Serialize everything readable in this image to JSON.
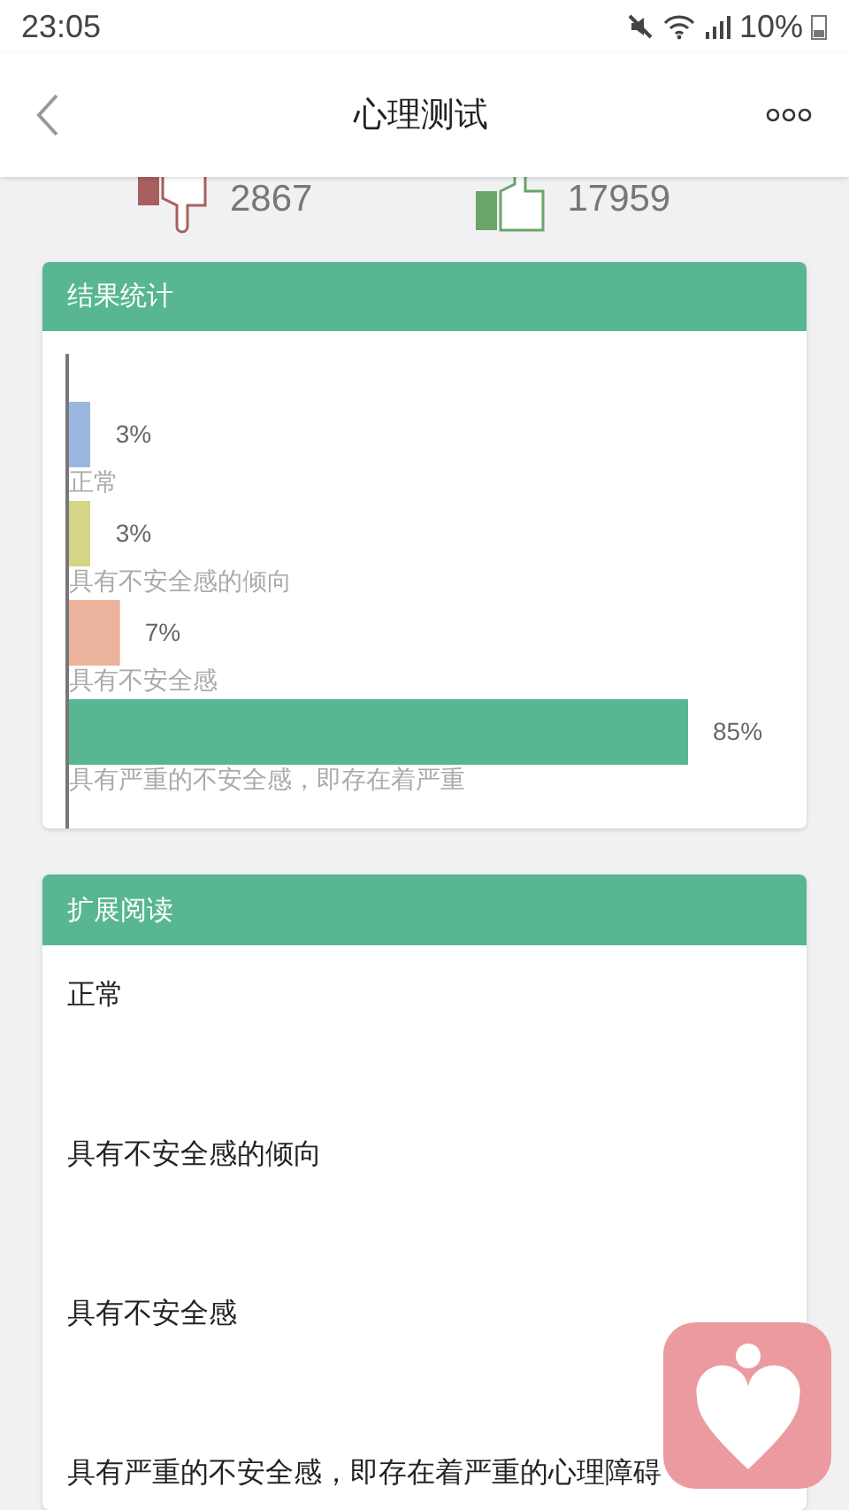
{
  "status_bar": {
    "time": "23:05",
    "battery": "10%"
  },
  "header": {
    "title": "心理测试"
  },
  "votes": {
    "dislikes": "2867",
    "likes": "17959"
  },
  "result_card": {
    "title": "结果统计",
    "chart_data": {
      "type": "bar",
      "orientation": "horizontal",
      "categories": [
        "正常",
        "具有不安全感的倾向",
        "具有不安全感",
        "具有严重的不安全感，即存在着严重"
      ],
      "values": [
        3,
        3,
        7,
        85
      ],
      "value_labels": [
        "3%",
        "3%",
        "7%",
        "85%"
      ],
      "colors": [
        "#9bb7df",
        "#d6d585",
        "#ebb39c",
        "#58b692"
      ]
    }
  },
  "reading_card": {
    "title": "扩展阅读",
    "items": [
      "正常",
      "具有不安全感的倾向",
      "具有不安全感",
      "具有严重的不安全感，即存在着严重的心理障碍"
    ]
  }
}
